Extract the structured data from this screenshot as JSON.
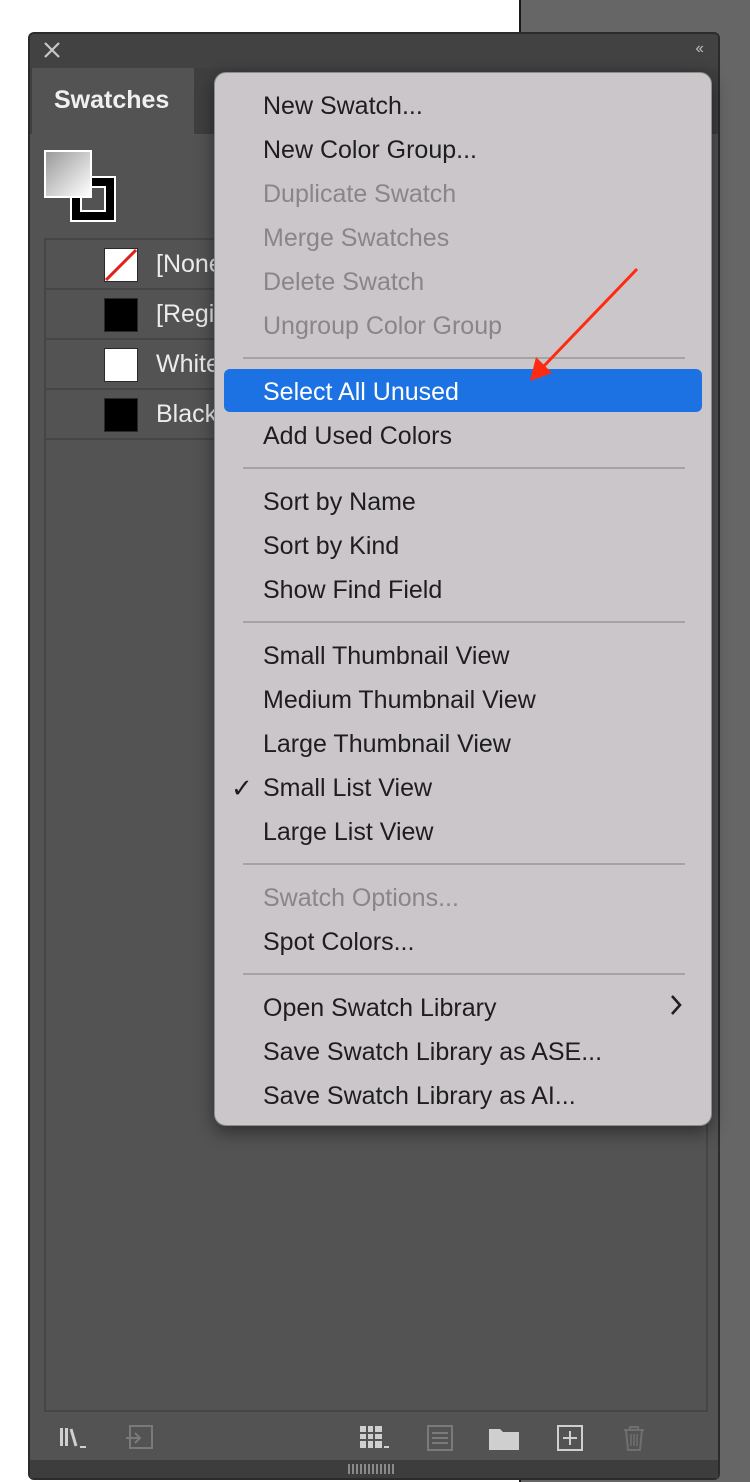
{
  "panel": {
    "active_tab": "Swatches",
    "collapse_label": "‹‹"
  },
  "swatches": [
    {
      "name": "[None]",
      "display": "[None",
      "type": "none"
    },
    {
      "name": "[Registration]",
      "display": "[Regi",
      "color": "#000000"
    },
    {
      "name": "White",
      "display": "White",
      "color": "#ffffff"
    },
    {
      "name": "Black",
      "display": "Black",
      "color": "#000000"
    }
  ],
  "menu": {
    "items": [
      {
        "label": "New Swatch...",
        "enabled": true
      },
      {
        "label": "New Color Group...",
        "enabled": true
      },
      {
        "label": "Duplicate Swatch",
        "enabled": false
      },
      {
        "label": "Merge Swatches",
        "enabled": false
      },
      {
        "label": "Delete Swatch",
        "enabled": false
      },
      {
        "label": "Ungroup Color Group",
        "enabled": false
      },
      {
        "label": "Select All Unused",
        "enabled": true,
        "highlighted": true
      },
      {
        "label": "Add Used Colors",
        "enabled": true
      },
      {
        "label": "Sort by Name",
        "enabled": true
      },
      {
        "label": "Sort by Kind",
        "enabled": true
      },
      {
        "label": "Show Find Field",
        "enabled": true
      },
      {
        "label": "Small Thumbnail View",
        "enabled": true
      },
      {
        "label": "Medium Thumbnail View",
        "enabled": true
      },
      {
        "label": "Large Thumbnail View",
        "enabled": true
      },
      {
        "label": "Small List View",
        "enabled": true,
        "checked": true
      },
      {
        "label": "Large List View",
        "enabled": true
      },
      {
        "label": "Swatch Options...",
        "enabled": false
      },
      {
        "label": "Spot Colors...",
        "enabled": true
      },
      {
        "label": "Open Swatch Library",
        "enabled": true,
        "submenu": true
      },
      {
        "label": "Save Swatch Library as ASE...",
        "enabled": true
      },
      {
        "label": "Save Swatch Library as AI...",
        "enabled": true
      }
    ],
    "check_glyph": "✓",
    "highlight_color": "#1d72e3"
  },
  "annotation": {
    "arrow_color": "#ff2a12"
  }
}
